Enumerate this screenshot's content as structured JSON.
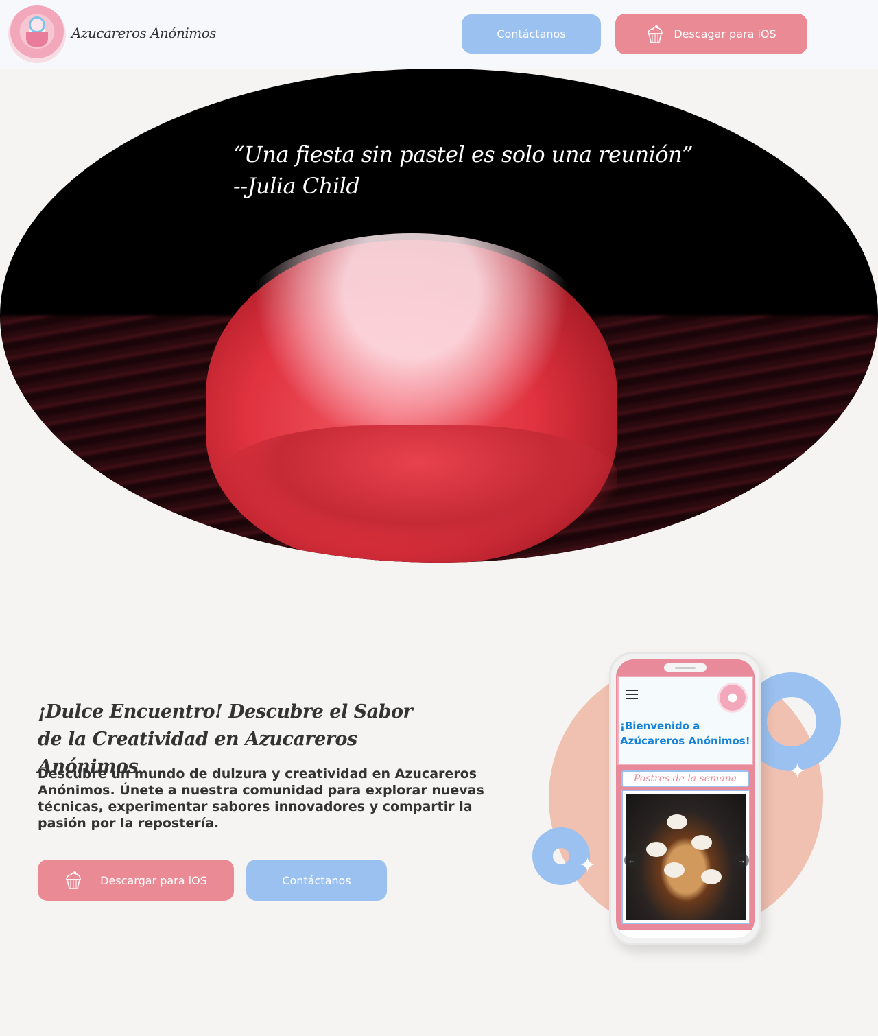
{
  "header": {
    "brand": "Azucareros Anónimos",
    "contact_label": "Contáctanos",
    "download_label": "Descagar para iOS"
  },
  "hero": {
    "quote_line1": "“Una fiesta sin pastel es solo una reunión”",
    "quote_line2": "--Julia Child"
  },
  "main": {
    "title": "¡Dulce Encuentro! Descubre el Sabor de la Creatividad en Azucareros Anónimos",
    "description": "Descubre un mundo de dulzura y creatividad en Azucareros Anónimos. Únete a nuestra comunidad para explorar nuevas técnicas, experimentar sabores innovadores y compartir la pasión por la repostería.",
    "download_label": "Descargar para iOS",
    "contact_label": "Contáctanos"
  },
  "phone": {
    "welcome": "¡Bienvenido a Azúcareros Anónimos!",
    "section_title": "Postres de la semana",
    "prev_arrow": "←",
    "next_arrow": "→"
  },
  "colors": {
    "accent_pink": "#ea8a95",
    "accent_blue": "#9bc1f0",
    "background": "#f5f4f2",
    "header_bg": "#f7f8fc"
  },
  "icons": [
    "cupcake-icon",
    "menu-icon",
    "arrow-left-icon",
    "arrow-right-icon",
    "sparkle-icon"
  ]
}
